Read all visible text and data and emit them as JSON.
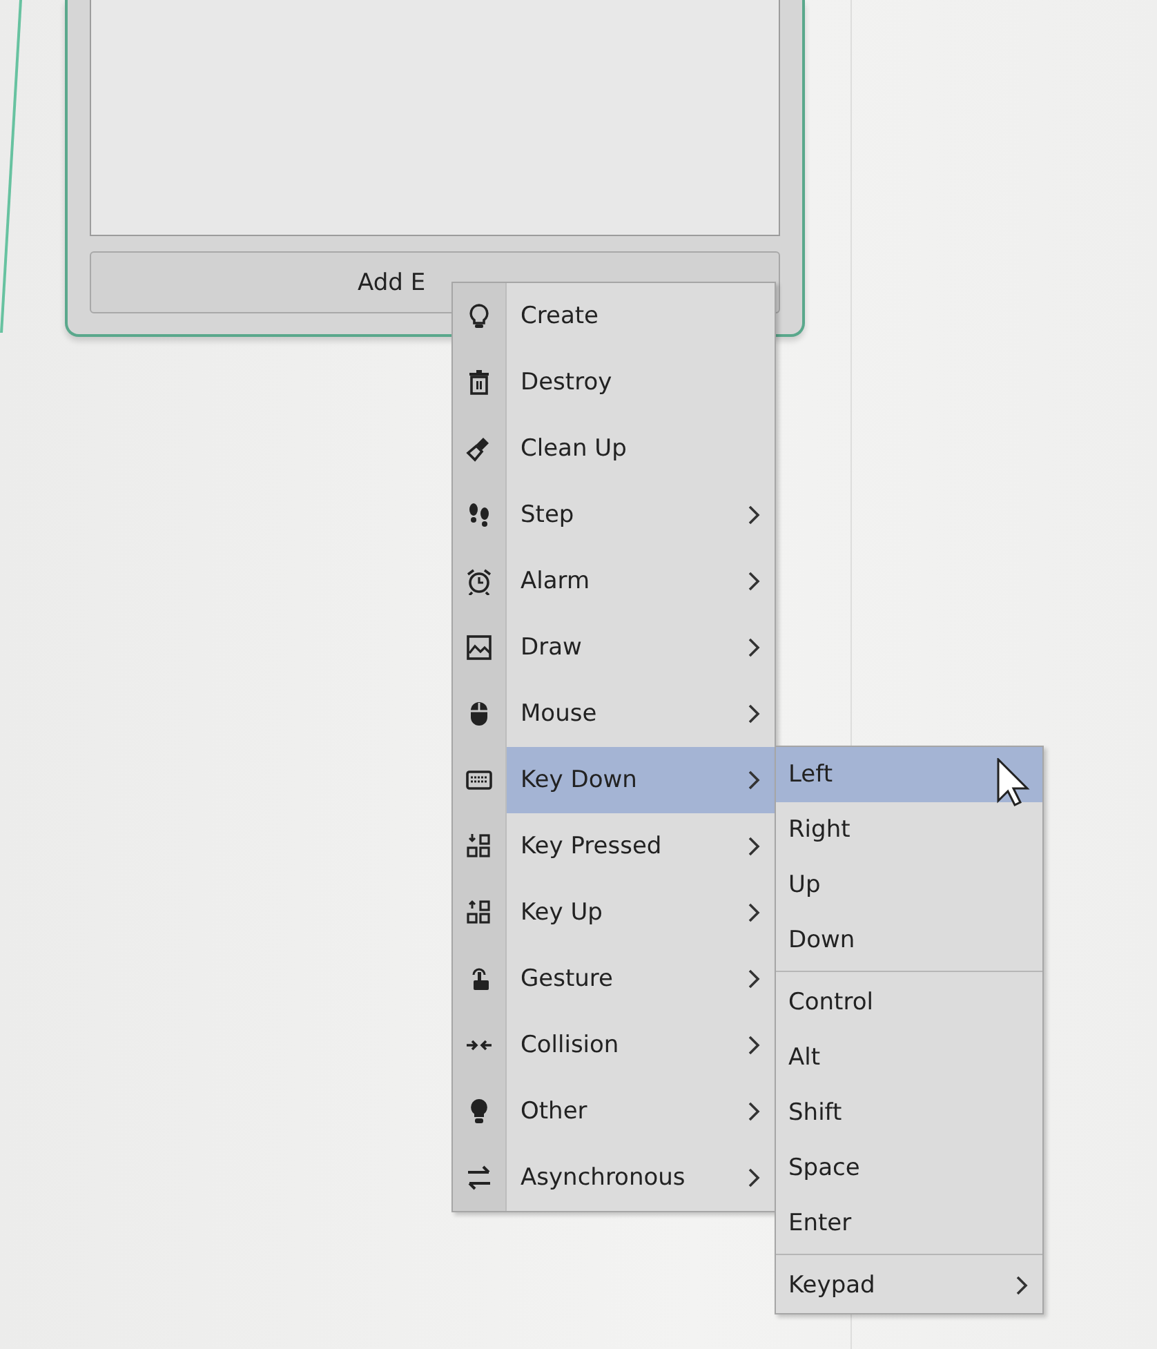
{
  "panel": {
    "add_button": "Add E"
  },
  "event_menu": [
    {
      "label": "Create",
      "has_submenu": false,
      "selected": false
    },
    {
      "label": "Destroy",
      "has_submenu": false,
      "selected": false
    },
    {
      "label": "Clean Up",
      "has_submenu": false,
      "selected": false
    },
    {
      "label": "Step",
      "has_submenu": true,
      "selected": false
    },
    {
      "label": "Alarm",
      "has_submenu": true,
      "selected": false
    },
    {
      "label": "Draw",
      "has_submenu": true,
      "selected": false
    },
    {
      "label": "Mouse",
      "has_submenu": true,
      "selected": false
    },
    {
      "label": "Key Down",
      "has_submenu": true,
      "selected": true
    },
    {
      "label": "Key Pressed",
      "has_submenu": true,
      "selected": false
    },
    {
      "label": "Key Up",
      "has_submenu": true,
      "selected": false
    },
    {
      "label": "Gesture",
      "has_submenu": true,
      "selected": false
    },
    {
      "label": "Collision",
      "has_submenu": true,
      "selected": false
    },
    {
      "label": "Other",
      "has_submenu": true,
      "selected": false
    },
    {
      "label": "Asynchronous",
      "has_submenu": true,
      "selected": false
    }
  ],
  "key_submenu": [
    [
      {
        "label": "Left",
        "has_submenu": false,
        "selected": true
      },
      {
        "label": "Right",
        "has_submenu": false,
        "selected": false
      },
      {
        "label": "Up",
        "has_submenu": false,
        "selected": false
      },
      {
        "label": "Down",
        "has_submenu": false,
        "selected": false
      }
    ],
    [
      {
        "label": "Control",
        "has_submenu": false,
        "selected": false
      },
      {
        "label": "Alt",
        "has_submenu": false,
        "selected": false
      },
      {
        "label": "Shift",
        "has_submenu": false,
        "selected": false
      },
      {
        "label": "Space",
        "has_submenu": false,
        "selected": false
      },
      {
        "label": "Enter",
        "has_submenu": false,
        "selected": false
      }
    ],
    [
      {
        "label": "Keypad",
        "has_submenu": true,
        "selected": false
      }
    ]
  ]
}
